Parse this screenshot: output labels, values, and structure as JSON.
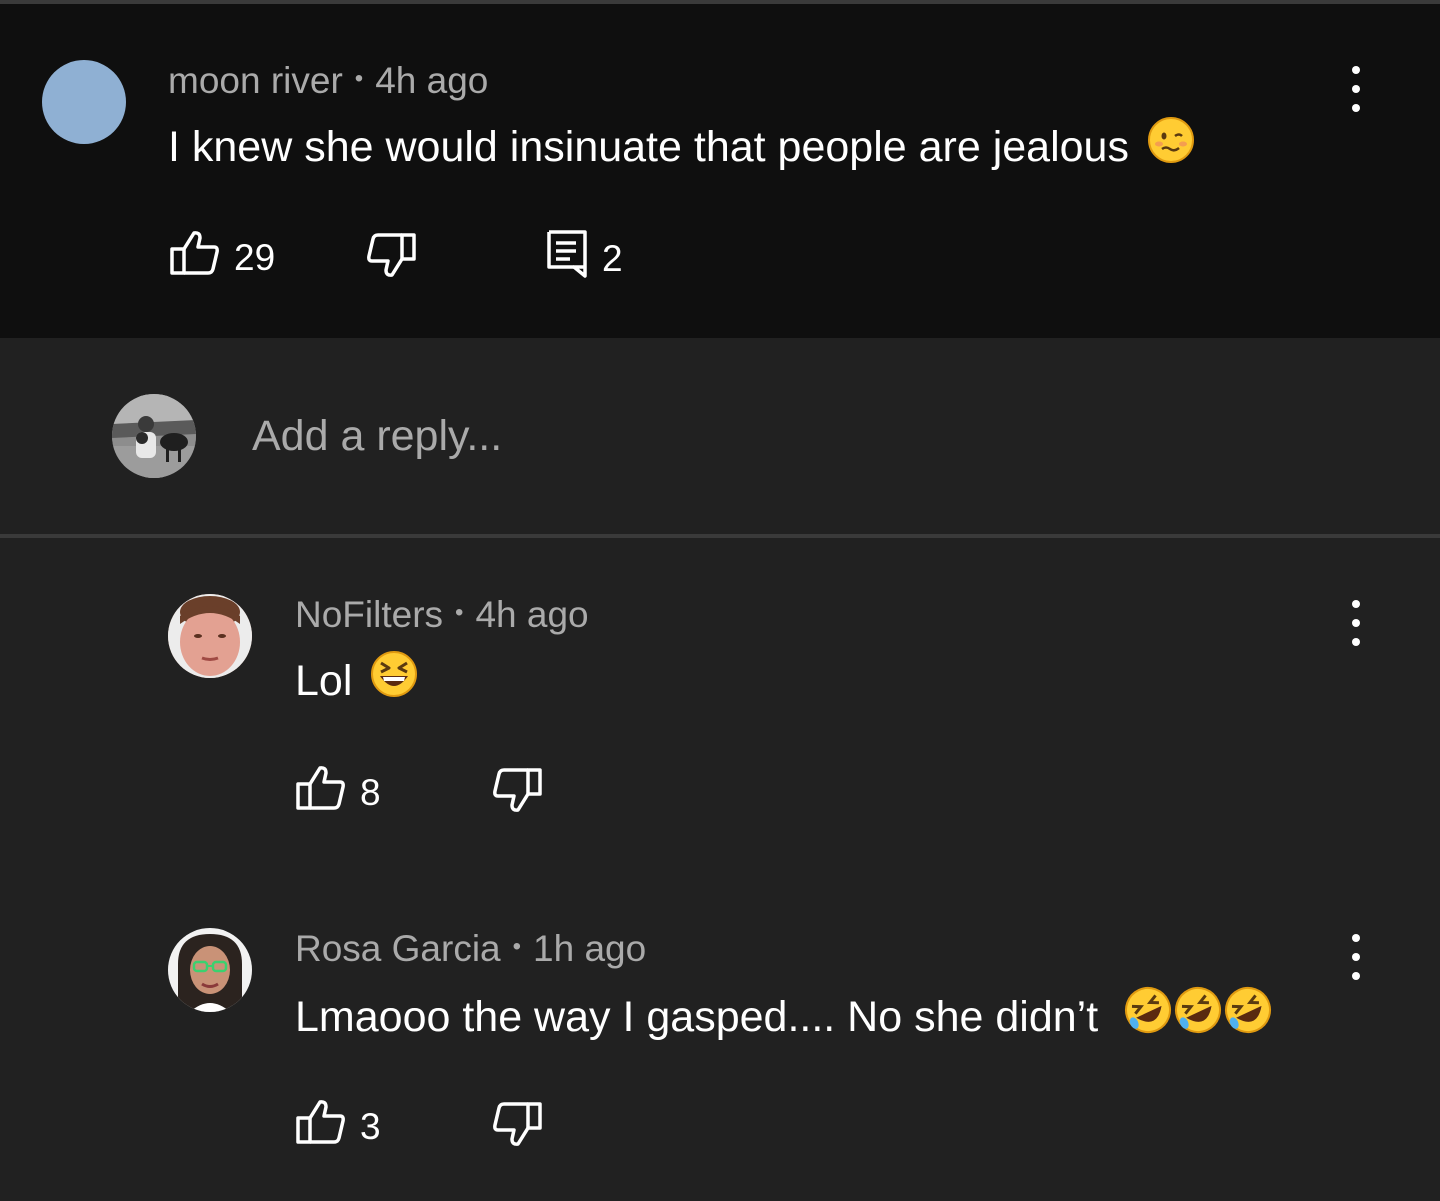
{
  "parent_comment": {
    "author": "moon river",
    "time": "4h ago",
    "text": "I knew she would insinuate that people are jealous",
    "emoji": "woozy-face",
    "likes": "29",
    "replies": "2"
  },
  "reply_box": {
    "placeholder": "Add a reply..."
  },
  "replies": [
    {
      "author": "NoFilters",
      "time": "4h ago",
      "text": "Lol",
      "emoji": "laughing-face",
      "likes": "8"
    },
    {
      "author": "Rosa Garcia",
      "time": "1h ago",
      "text": "Lmaooo the way I gasped.... No she didn’t",
      "emoji": "rolling-on-floor-laughing x3",
      "likes": "3"
    }
  ],
  "colors": {
    "parent_bg": "#0f0f0f",
    "page_bg": "#212121",
    "meta_text": "#aaaaaa",
    "avatar_moon_river": "#8fb0d3"
  }
}
